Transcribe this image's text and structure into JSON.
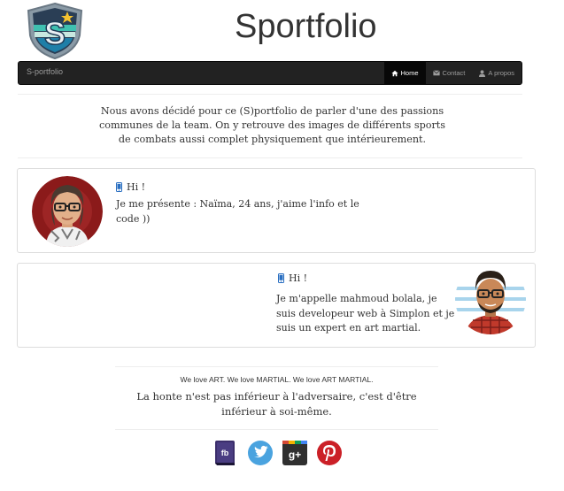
{
  "header": {
    "title": "Sportfolio",
    "logo_letter": "S"
  },
  "navbar": {
    "brand": "S-portfolio",
    "items": [
      {
        "label": "Home",
        "icon": "home-icon",
        "active": true
      },
      {
        "label": "Contact",
        "icon": "envelope-icon",
        "active": false
      },
      {
        "label": "A propos",
        "icon": "user-icon",
        "active": false
      }
    ]
  },
  "intro": {
    "text": "Nous avons décidé pour ce (S)portfolio de parler d'une des passions communes de la team. On y retrouve des images de différents sports de combats aussi complet physiquement que intérieurement."
  },
  "profiles": [
    {
      "greeting": "Hi !",
      "text": "Je me présente : Naïma, 24 ans, j'aime l'info et le code ))",
      "icon": "phone-icon"
    },
    {
      "greeting": "Hi !",
      "text": "Je m'appelle mahmoud bolala, je suis developeur web à Simplon et je suis un expert en art martial.",
      "icon": "phone-icon"
    }
  ],
  "footer": {
    "tagline": "We love ART. We love MARTIAL. We love ART MARTIAL.",
    "quote": "La honte n'est pas inférieur à l'adversaire, c'est d'être inférieur à soi-même.",
    "social": [
      {
        "name": "facebook-icon",
        "label": "fb",
        "color": "#3b2e6b"
      },
      {
        "name": "twitter-icon",
        "label": "",
        "color": "#4aa3df"
      },
      {
        "name": "google-plus-icon",
        "label": "g+",
        "color": "#2f2f2f"
      },
      {
        "name": "pinterest-icon",
        "label": "",
        "color": "#cb2027"
      }
    ]
  },
  "colors": {
    "navbar_bg": "#222222",
    "active_nav_bg": "#080808",
    "phone_icon": "#2a6fc1"
  }
}
